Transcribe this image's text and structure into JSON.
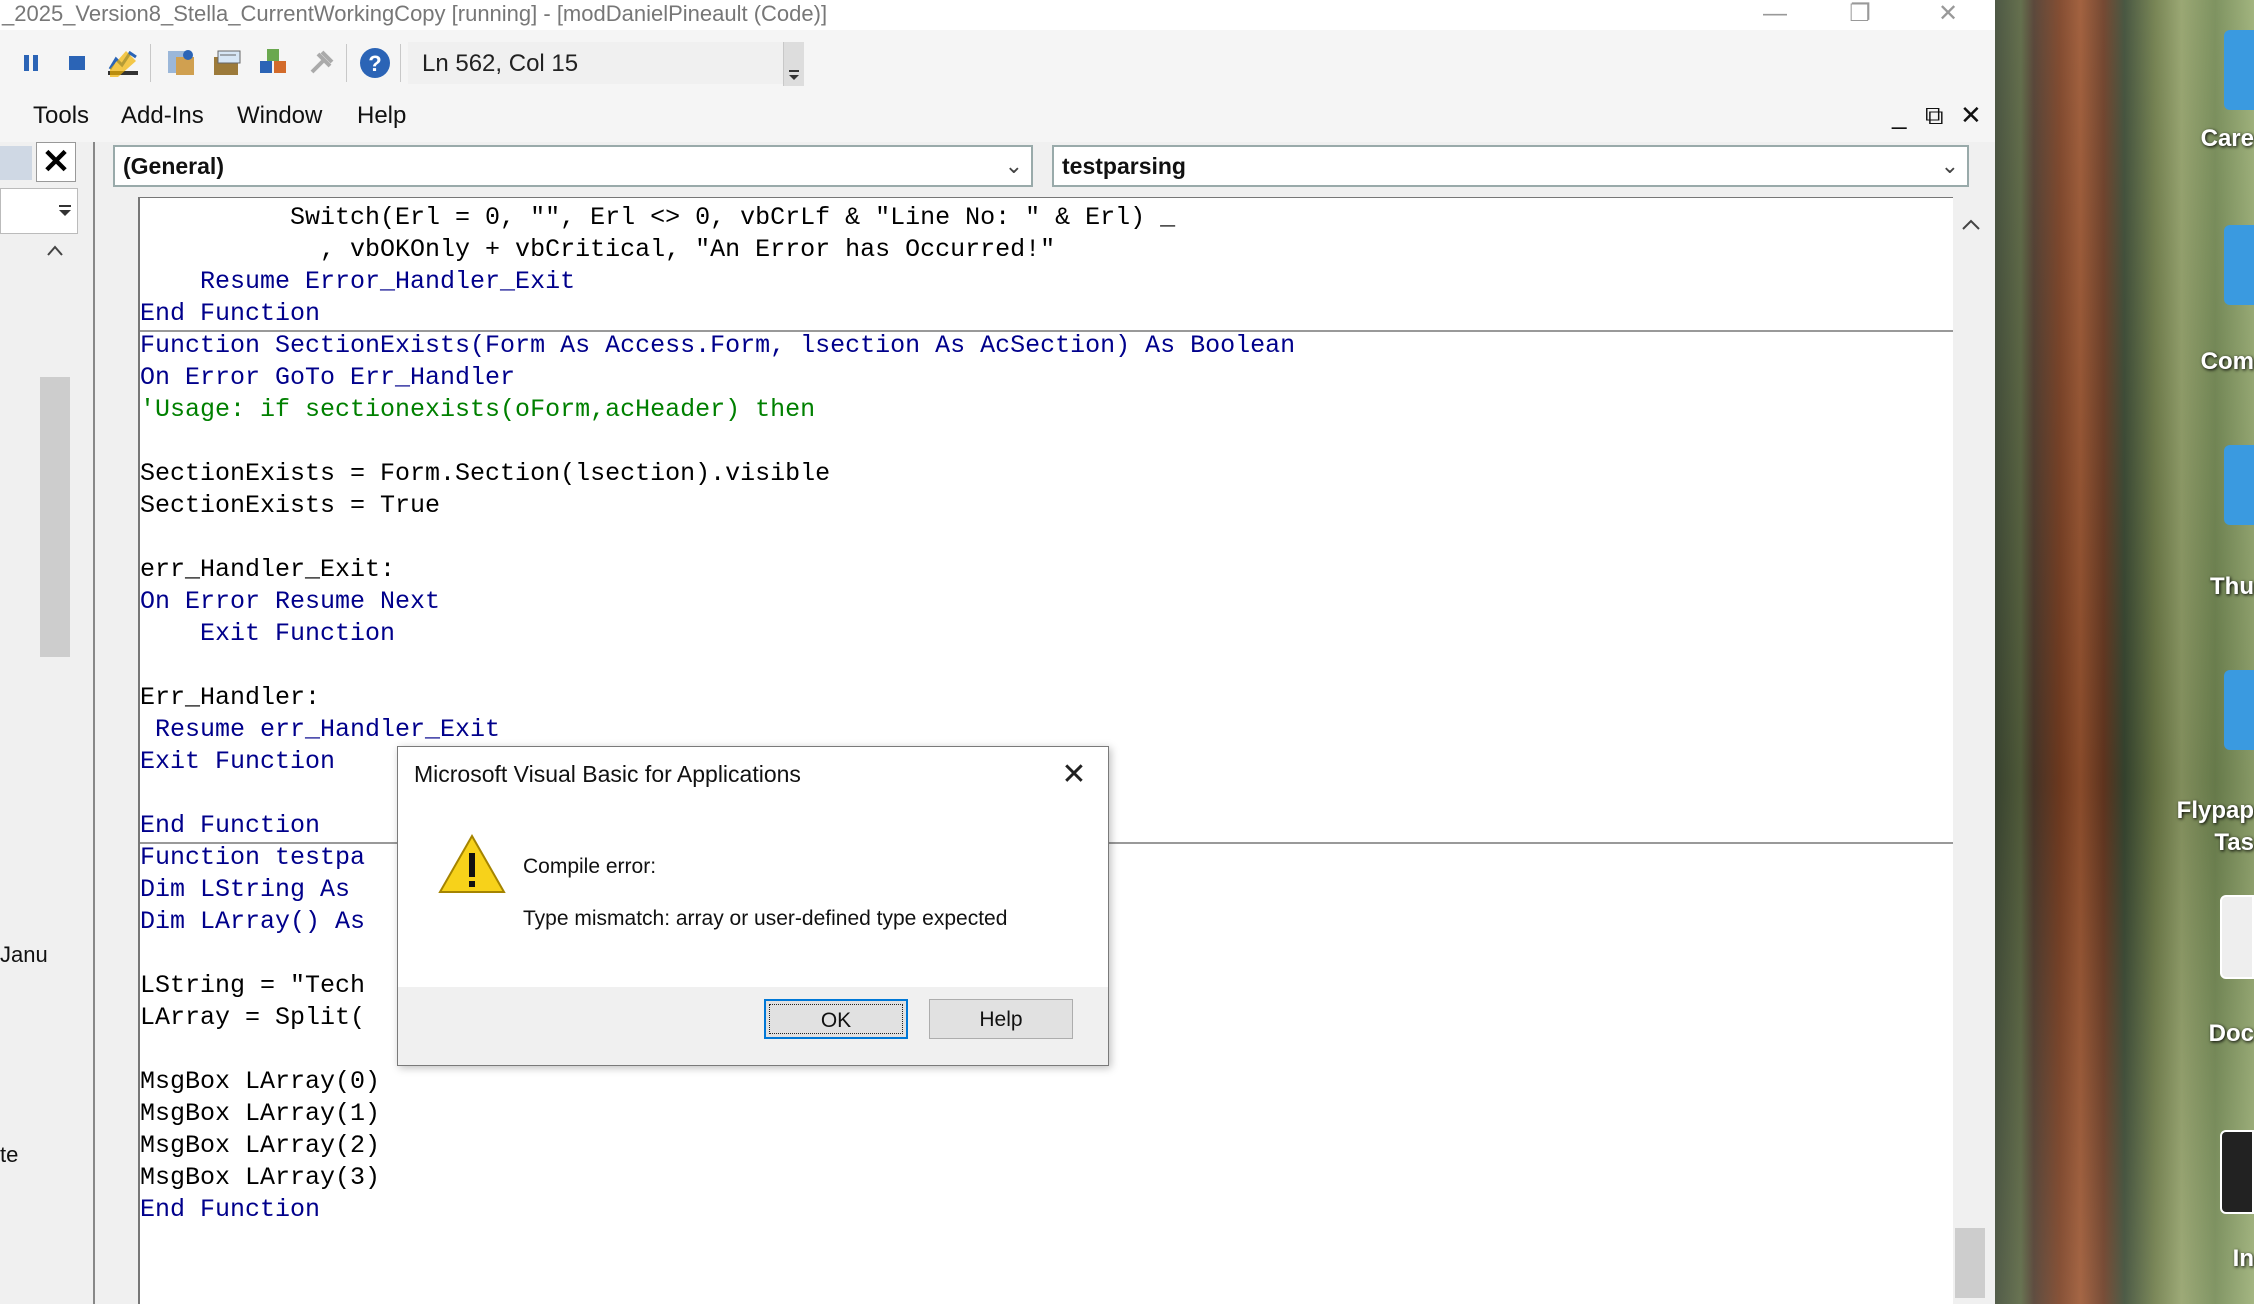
{
  "window": {
    "title": "_2025_Version8_Stella_CurrentWorkingCopy [running] - [modDanielPineault (Code)]",
    "minimize": "—",
    "restore": "❐",
    "close": "✕"
  },
  "toolbar": {
    "status": "Ln 562, Col 15",
    "icons": [
      "pause-icon",
      "stop-icon",
      "design-mode-icon",
      "project-explorer-icon",
      "properties-window-icon",
      "object-browser-icon",
      "toolbox-icon",
      "help-icon"
    ]
  },
  "menu": {
    "items": [
      "Tools",
      "Add-Ins",
      "Window",
      "Help"
    ],
    "mdi_minimize": "_",
    "mdi_restore": "⧉",
    "mdi_close": "✕"
  },
  "left_pane": {
    "close": "✕",
    "frag1": "Janu",
    "frag2": "te"
  },
  "code_window": {
    "object_combo": "(General)",
    "procedure_combo": "testparsing",
    "lines": [
      "          Switch(Erl = 0, \"\", Erl <> 0, vbCrLf & \"Line No: \" & Erl) _",
      "            , vbOKOnly + vbCritical, \"An Error has Occurred!\"",
      "    Resume Error_Handler_Exit",
      "End Function",
      "Function SectionExists(Form As Access.Form, lsection As AcSection) As Boolean",
      "On Error GoTo Err_Handler",
      "'Usage: if sectionexists(oForm,acHeader) then",
      "",
      "SectionExists = Form.Section(lsection).visible",
      "SectionExists = True",
      "",
      "err_Handler_Exit:",
      "On Error Resume Next",
      "    Exit Function",
      "",
      "Err_Handler:",
      " Resume err_Handler_Exit",
      "Exit Function",
      "",
      "End Function",
      "Function testpa",
      "Dim LString As",
      "Dim LArray() As",
      "",
      "LString = \"Tech",
      "LArray = Split(",
      "",
      "MsgBox LArray(0)",
      "MsgBox LArray(1)",
      "MsgBox LArray(2)",
      "MsgBox LArray(3)",
      "End Function"
    ]
  },
  "dialog": {
    "title": "Microsoft Visual Basic for Applications",
    "close": "✕",
    "message_heading": "Compile error:",
    "message_body": "Type mismatch: array or user-defined type expected",
    "ok_label": "OK",
    "help_label": "Help"
  },
  "desktop": {
    "labels": [
      "Care",
      "Com",
      "Thu",
      "Flypap",
      "Tas",
      "Doc",
      "In"
    ]
  },
  "colors": {
    "keyword": "#00008b",
    "comment": "#008000",
    "focus_border": "#0078d7"
  }
}
